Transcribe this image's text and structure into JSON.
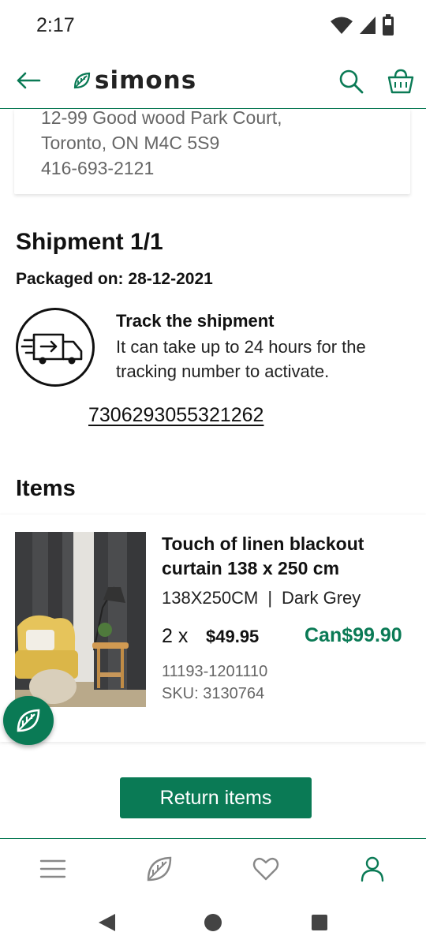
{
  "status_bar": {
    "time": "2:17",
    "icons": [
      "wifi-icon",
      "signal-icon",
      "battery-icon"
    ]
  },
  "header": {
    "brand": "simons",
    "icons": [
      "back-arrow-icon",
      "leaf-logo-icon",
      "search-icon",
      "shopping-bag-icon"
    ]
  },
  "address": {
    "line1": "12-99 Good wood Park Court,",
    "line2": "Toronto, ON M4C 5S9",
    "phone": "416-693-2121"
  },
  "shipment": {
    "title": "Shipment 1/1",
    "packaged_label": "Packaged on:",
    "packaged_date": "28-12-2021",
    "track_title": "Track the shipment",
    "track_desc": "It can take up to 24 hours for the tracking number to activate.",
    "tracking_number": "7306293055321262"
  },
  "items_section": {
    "title": "Items",
    "items": [
      {
        "name": "Touch of linen blackout curtain 138 x 250 cm",
        "size": "138X250CM",
        "separator": "|",
        "color": "Dark Grey",
        "qty": "2 x",
        "unit_price": "$49.95",
        "total": "Can$99.90",
        "code": "11193-1201110",
        "sku": "SKU: 3130764"
      }
    ]
  },
  "actions": {
    "return_label": "Return items"
  },
  "bottom_nav": {
    "items": [
      "menu-icon",
      "leaf-icon",
      "heart-icon",
      "account-icon"
    ],
    "active": "account-icon"
  },
  "colors": {
    "brand_green": "#0a7a55",
    "text_dark": "#111111",
    "text_muted": "#666666"
  }
}
